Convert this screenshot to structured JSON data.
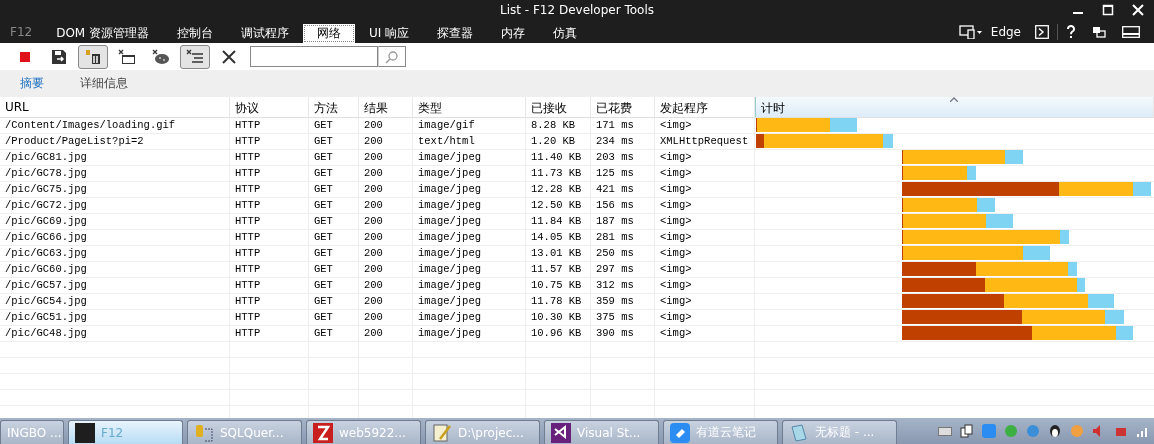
{
  "window": {
    "title": "List - F12 Developer Tools"
  },
  "app_label": "F12",
  "tabs": [
    {
      "label": "DOM 资源管理器",
      "selected": false
    },
    {
      "label": "控制台",
      "selected": false
    },
    {
      "label": "调试程序",
      "selected": false
    },
    {
      "label": "网络",
      "selected": true
    },
    {
      "label": "UI 响应",
      "selected": false
    },
    {
      "label": "探查器",
      "selected": false
    },
    {
      "label": "内存",
      "selected": false
    },
    {
      "label": "仿真",
      "selected": false
    }
  ],
  "browser_mode": "Edge",
  "toolbar": [
    {
      "kind": "stop",
      "pressed": false
    },
    {
      "kind": "save",
      "pressed": false
    },
    {
      "kind": "cache",
      "pressed": true
    },
    {
      "kind": "clear-cache",
      "pressed": false
    },
    {
      "kind": "cookie",
      "pressed": false
    },
    {
      "kind": "list",
      "pressed": true
    },
    {
      "kind": "clear",
      "pressed": false
    }
  ],
  "subtabs": [
    {
      "label": "摘要",
      "selected": true
    },
    {
      "label": "详细信息",
      "selected": false
    }
  ],
  "table": {
    "columns": [
      "URL",
      "协议",
      "方法",
      "结果",
      "类型",
      "已接收",
      "已花费",
      "发起程序",
      "计时"
    ],
    "rows": [
      [
        "/Content/Images/loading.gif",
        "HTTP",
        "GET",
        "200",
        "image/gif",
        "8.28 KB",
        "171 ms",
        "<img>"
      ],
      [
        "/Product/PageList?pi=2",
        "HTTP",
        "GET",
        "200",
        "text/html",
        "1.20 KB",
        "234 ms",
        "XMLHttpRequest"
      ],
      [
        "/pic/GC81.jpg",
        "HTTP",
        "GET",
        "200",
        "image/jpeg",
        "11.40 KB",
        "203 ms",
        "<img>"
      ],
      [
        "/pic/GC78.jpg",
        "HTTP",
        "GET",
        "200",
        "image/jpeg",
        "11.73 KB",
        "125 ms",
        "<img>"
      ],
      [
        "/pic/GC75.jpg",
        "HTTP",
        "GET",
        "200",
        "image/jpeg",
        "12.28 KB",
        "421 ms",
        "<img>"
      ],
      [
        "/pic/GC72.jpg",
        "HTTP",
        "GET",
        "200",
        "image/jpeg",
        "12.50 KB",
        "156 ms",
        "<img>"
      ],
      [
        "/pic/GC69.jpg",
        "HTTP",
        "GET",
        "200",
        "image/jpeg",
        "11.84 KB",
        "187 ms",
        "<img>"
      ],
      [
        "/pic/GC66.jpg",
        "HTTP",
        "GET",
        "200",
        "image/jpeg",
        "14.05 KB",
        "281 ms",
        "<img>"
      ],
      [
        "/pic/GC63.jpg",
        "HTTP",
        "GET",
        "200",
        "image/jpeg",
        "13.01 KB",
        "250 ms",
        "<img>"
      ],
      [
        "/pic/GC60.jpg",
        "HTTP",
        "GET",
        "200",
        "image/jpeg",
        "11.57 KB",
        "297 ms",
        "<img>"
      ],
      [
        "/pic/GC57.jpg",
        "HTTP",
        "GET",
        "200",
        "image/jpeg",
        "10.75 KB",
        "312 ms",
        "<img>"
      ],
      [
        "/pic/GC54.jpg",
        "HTTP",
        "GET",
        "200",
        "image/jpeg",
        "11.78 KB",
        "359 ms",
        "<img>"
      ],
      [
        "/pic/GC51.jpg",
        "HTTP",
        "GET",
        "200",
        "image/jpeg",
        "10.30 KB",
        "375 ms",
        "<img>"
      ],
      [
        "/pic/GC48.jpg",
        "HTTP",
        "GET",
        "200",
        "image/jpeg",
        "10.96 KB",
        "390 ms",
        "<img>"
      ]
    ]
  },
  "taskbar": [
    {
      "label": "INGBO ...",
      "selected": false
    },
    {
      "label": "F12",
      "selected": true
    },
    {
      "label": "SQLQuer...",
      "selected": false
    },
    {
      "label": "web5922...",
      "selected": false
    },
    {
      "label": "D:\\projec...",
      "selected": false
    },
    {
      "label": "Visual St...",
      "selected": false
    },
    {
      "label": "有道云笔记",
      "selected": false
    },
    {
      "label": "无标题 - ...",
      "selected": false
    }
  ]
}
